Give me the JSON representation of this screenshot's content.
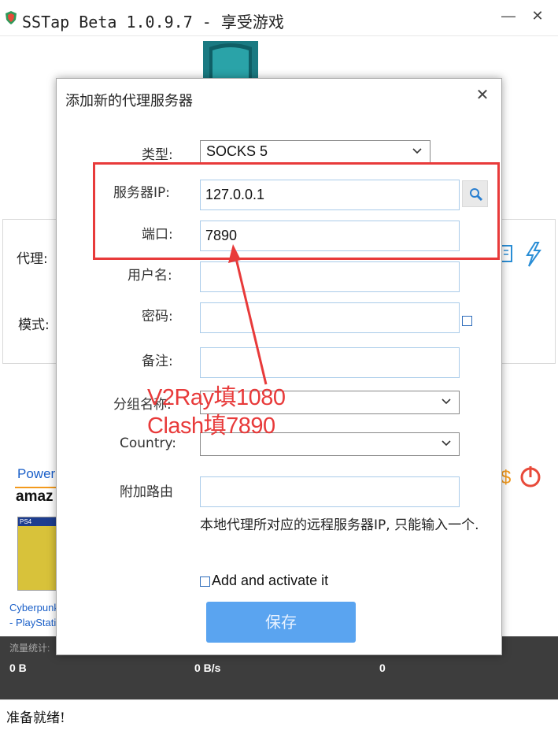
{
  "window": {
    "title": "SSTap Beta 1.0.9.7 - 享受游戏",
    "minimize_glyph": "—",
    "close_glyph": "✕",
    "icon": "app-shield-icon"
  },
  "main": {
    "proxy_label": "代理:",
    "mode_label": "模式:",
    "ad": {
      "power_text": "Power",
      "amazon_text": "amaz",
      "product_badge": "PS4",
      "product_line1": "Cyberpunk",
      "product_line2": "- PlayStati"
    },
    "stats": {
      "label": "流量统计:",
      "total": "0 B",
      "speed": "0 B/s",
      "count": "0"
    },
    "status": "准备就绪!"
  },
  "dialog": {
    "title": "添加新的代理服务器",
    "close_glyph": "✕",
    "type_label": "类型:",
    "type_value": "SOCKS 5",
    "server_ip_label": "服务器IP:",
    "server_ip_value": "127.0.0.1",
    "port_label": "端口:",
    "port_value": "7890",
    "username_label": "用户名:",
    "username_value": "",
    "password_label": "密码:",
    "password_value": "",
    "note_label": "备注:",
    "note_value": "",
    "group_label": "分组名称:",
    "group_value": "",
    "country_label": "Country:",
    "country_value": "",
    "extra_route_label": "附加路由",
    "extra_route_value": "",
    "hint": "本地代理所对应的远程服务器IP, 只能输入一个.",
    "activate_label": "Add and activate it",
    "save_label": "保存"
  },
  "annotation": {
    "line1": "V2Ray填1080",
    "line2": "Clash填7890",
    "color": "#e83a3a"
  },
  "colors": {
    "accent": "#5aa4f0",
    "field_border": "#a9cbe9",
    "stats_bg": "#3d3d3d"
  }
}
